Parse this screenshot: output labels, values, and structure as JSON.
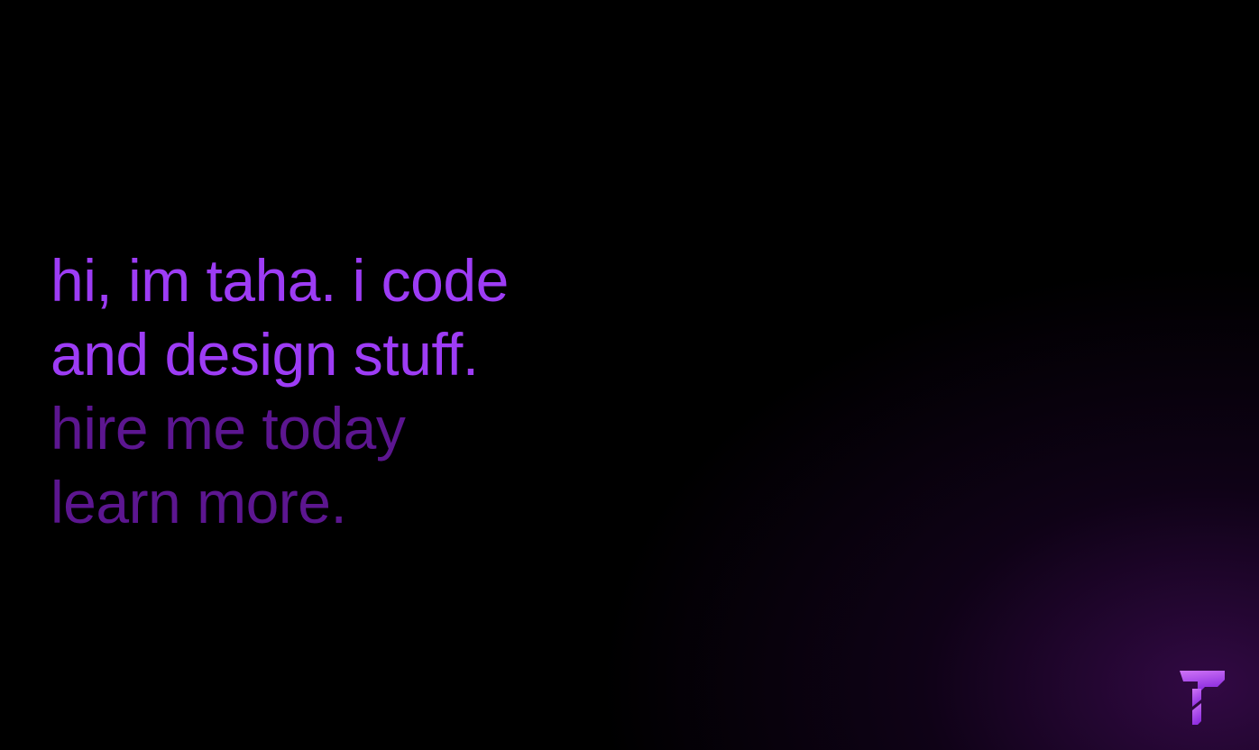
{
  "hero": {
    "line1": "hi, im taha. i code",
    "line2": "and design stuff.",
    "hire_link": "hire me today",
    "learn_link": "learn more."
  },
  "logo": {
    "icon": "t-monogram-logo-icon"
  },
  "colors": {
    "background": "#000000",
    "glow": "#5a0f80",
    "primary_text": "#9d3cf5",
    "link_text": "#5c1690",
    "logo_top": "#c86df5",
    "logo_bottom": "#8a2be2"
  }
}
